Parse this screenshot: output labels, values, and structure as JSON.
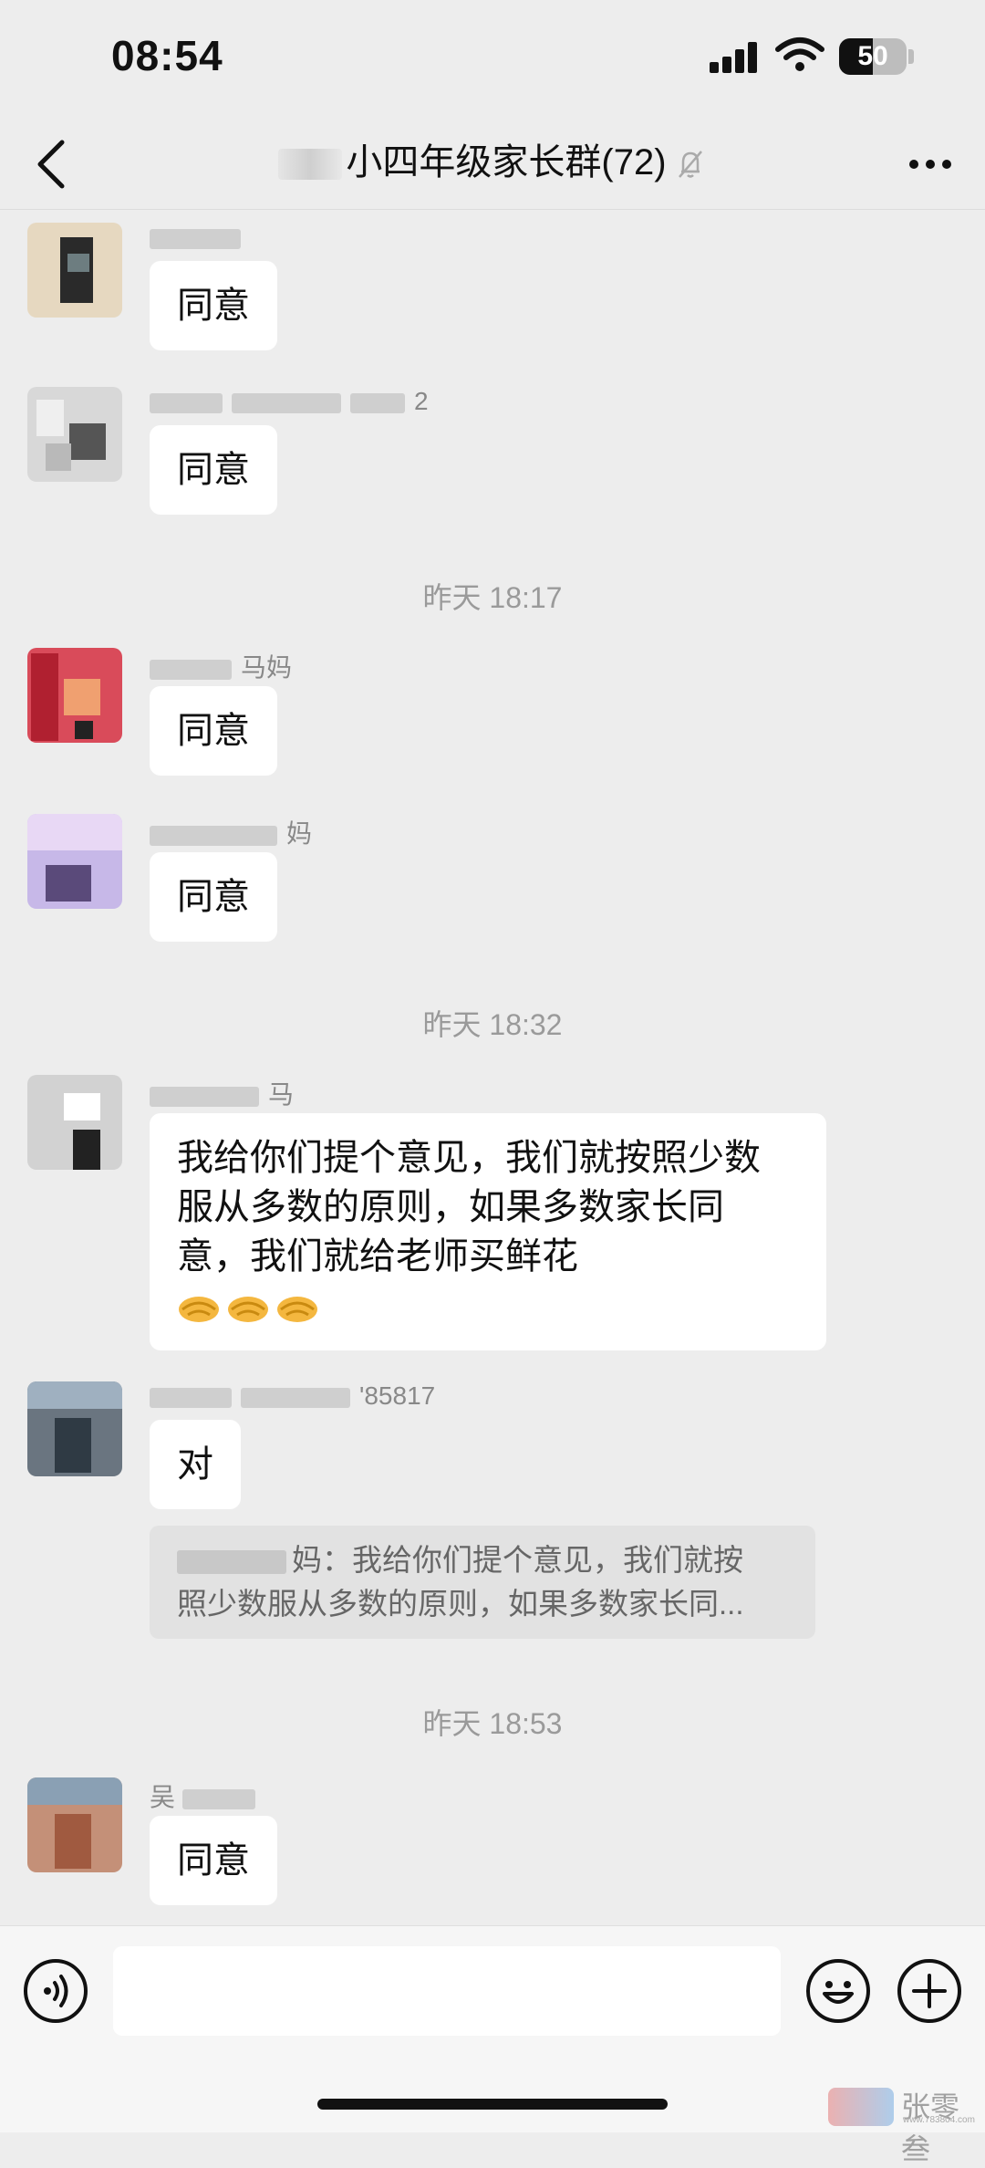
{
  "status_bar": {
    "time": "08:54",
    "battery": "50",
    "battery_level": 0.5
  },
  "nav": {
    "title": "小四年级家长群(72)"
  },
  "messages": [
    {
      "sender": "",
      "text": "同意"
    },
    {
      "sender": "2",
      "text": "同意"
    },
    {
      "sender": "马妈",
      "text": "同意"
    },
    {
      "sender": "妈",
      "text": "同意"
    },
    {
      "sender": "马",
      "text": "我给你们提个意见，我们就按照少数服从多数的原则，如果多数家长同意，我们就给老师买鲜花",
      "line1": "我给你们提个意见，我们就按照少数",
      "line2": "服从多数的原则，如果多数家长同",
      "line3": "意，我们就给老师买鲜花"
    },
    {
      "sender": "'85817",
      "text": "对"
    },
    {
      "sender": "吴",
      "text": "同意"
    }
  ],
  "timestamps": [
    "昨天 18:17",
    "昨天 18:32",
    "昨天 18:53"
  ],
  "quote": {
    "line1": "妈：我给你们提个意见，我们就按",
    "line2": "照少数服从多数的原则，如果多数家长同..."
  },
  "icons": [
    "back-icon",
    "mute-icon",
    "more-icon",
    "voice-icon",
    "emoji-icon",
    "plus-icon",
    "handshake-icon"
  ],
  "watermark": {
    "text": "张零叁",
    "url": "www.783804.com"
  }
}
